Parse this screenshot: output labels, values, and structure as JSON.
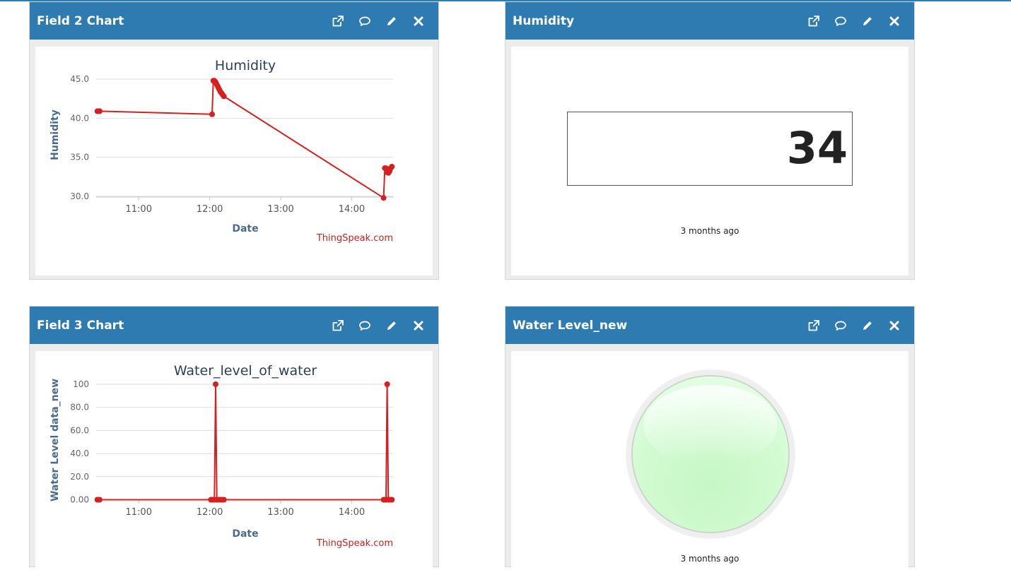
{
  "panels": {
    "field2": {
      "title": "Field 2 Chart",
      "credit": "ThingSpeak.com",
      "chart": {
        "title": "Humidity",
        "xlabel": "Date",
        "ylabel": "Humidity",
        "xticks": [
          "11:00",
          "12:00",
          "13:00",
          "14:00"
        ],
        "yticks": [
          "45.0",
          "40.0",
          "35.0",
          "30.0"
        ]
      }
    },
    "humidity": {
      "title": "Humidity",
      "value": "34",
      "updated": "3 months ago"
    },
    "field3": {
      "title": "Field 3 Chart",
      "credit": "ThingSpeak.com",
      "chart": {
        "title": "Water_level_of_water",
        "xlabel": "Date",
        "ylabel": "Water Level data_new",
        "xticks": [
          "11:00",
          "12:00",
          "13:00",
          "14:00"
        ],
        "yticks": [
          "100",
          "80.0",
          "60.0",
          "40.0",
          "20.0",
          "0.00"
        ]
      }
    },
    "water_level": {
      "title": "Water Level_new",
      "updated": "3 months ago",
      "lamp_color": "#c8f8c8"
    }
  },
  "icons": [
    "external-link-icon",
    "comment-icon",
    "pencil-icon",
    "close-icon"
  ],
  "colors": {
    "header": "#2e7bb2",
    "series": "#d62020",
    "credit": "#cc1f1f",
    "axis_title": "#4a6b8f"
  },
  "chart_data": [
    {
      "type": "line",
      "title": "Humidity",
      "xlabel": "Date",
      "ylabel": "Humidity",
      "ylim": [
        29,
        46
      ],
      "xlim": [
        "10:24",
        "14:35"
      ],
      "grid": true,
      "series": [
        {
          "x": [
            "10:25",
            "10:26",
            "10:27",
            "12:02",
            "12:03",
            "12:04",
            "12:05",
            "12:06",
            "12:07",
            "12:08",
            "12:09",
            "12:10",
            "12:11",
            "12:12",
            "14:27",
            "14:28",
            "14:29",
            "14:30",
            "14:31",
            "14:32",
            "14:33",
            "14:34"
          ],
          "values": [
            40.9,
            40.9,
            40.9,
            40.5,
            44.8,
            44.8,
            44.6,
            44.3,
            44.0,
            43.7,
            43.4,
            43.2,
            43.0,
            42.8,
            29.8,
            33.6,
            33.6,
            33.1,
            33.0,
            33.2,
            33.6,
            33.8
          ]
        }
      ]
    },
    {
      "type": "line",
      "title": "Water_level_of_water",
      "xlabel": "Date",
      "ylabel": "Water Level data_new",
      "ylim": [
        -4,
        100
      ],
      "xlim": [
        "10:24",
        "14:35"
      ],
      "grid": true,
      "series": [
        {
          "x": [
            "10:25",
            "10:26",
            "10:27",
            "12:01",
            "12:02",
            "12:03",
            "12:04",
            "12:05",
            "12:06",
            "12:07",
            "12:08",
            "12:09",
            "12:10",
            "12:11",
            "12:12",
            "14:27",
            "14:28",
            "14:29",
            "14:30",
            "14:31",
            "14:32",
            "14:33",
            "14:34"
          ],
          "values": [
            0,
            0,
            0,
            0,
            0,
            0,
            0,
            100,
            0,
            0,
            0,
            0,
            0,
            0,
            0,
            0,
            0,
            0,
            100,
            0,
            0,
            0,
            0
          ]
        }
      ]
    }
  ]
}
